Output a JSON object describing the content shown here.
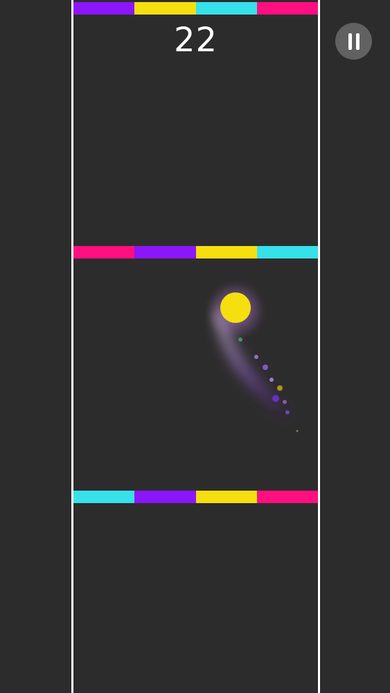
{
  "game": {
    "score": "22"
  },
  "colors": {
    "background": "#2d2c2d",
    "wall": "#ffffff",
    "purple": "#8c16fa",
    "yellow": "#f5df0f",
    "cyan": "#36e1ea",
    "magenta": "#ff0f80",
    "ball": "#f5df0f",
    "pause_button_bg": "#626162"
  },
  "bars": {
    "top": [
      "purple",
      "yellow",
      "cyan",
      "magenta"
    ],
    "middle": [
      "magenta",
      "purple",
      "yellow",
      "cyan"
    ],
    "bottom": [
      "cyan",
      "purple",
      "yellow",
      "magenta"
    ]
  },
  "controls": {
    "pause_icon": "pause-icon"
  }
}
